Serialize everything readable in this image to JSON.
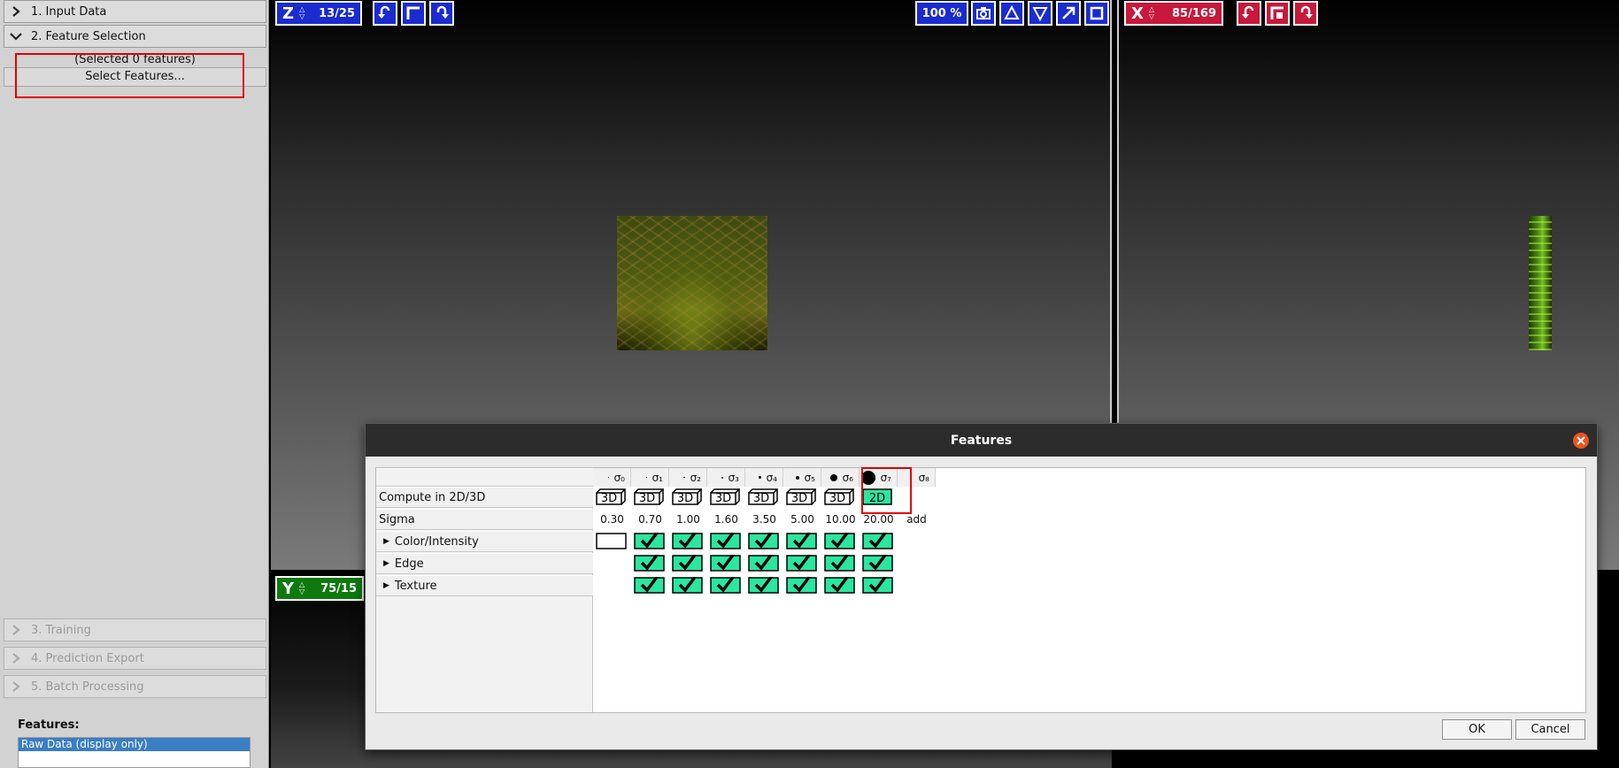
{
  "left_panel": {
    "drawers": [
      {
        "label": "1. Input Data",
        "expanded": false,
        "enabled": true
      },
      {
        "label": "2. Feature Selection",
        "expanded": true,
        "enabled": true
      },
      {
        "label": "3. Training",
        "expanded": false,
        "enabled": false
      },
      {
        "label": "4. Prediction Export",
        "expanded": false,
        "enabled": false
      },
      {
        "label": "5. Batch Processing",
        "expanded": false,
        "enabled": false
      }
    ],
    "selected_info": "(Selected 0 features)",
    "select_button": "Select Features...",
    "features_label": "Features:",
    "layer_item": "Raw Data (display only)"
  },
  "viewers": {
    "z": {
      "axis": "Z",
      "value": "13/25",
      "color": "#1a2bd0"
    },
    "x": {
      "axis": "X",
      "value": "85/169",
      "color": "#c8183b"
    },
    "y": {
      "axis": "Y",
      "value": "75/15",
      "color": "#0e7a0e"
    },
    "zoom": "100 %",
    "toolbar_icons": [
      "rotate-left-icon",
      "swap-axes-icon",
      "rotate-right-icon",
      "camera-icon",
      "triangle-up-icon",
      "triangle-down-icon",
      "maximize-icon",
      "square-icon"
    ]
  },
  "dialog": {
    "title": "Features",
    "row_labels": {
      "compute": "Compute in 2D/3D",
      "sigma": "Sigma",
      "groups": [
        "Color/Intensity",
        "Edge",
        "Texture"
      ]
    },
    "columns": [
      {
        "symbol": "σ₀",
        "mode": "3D",
        "sigma": "0.30"
      },
      {
        "symbol": "σ₁",
        "mode": "3D",
        "sigma": "0.70"
      },
      {
        "symbol": "σ₂",
        "mode": "3D",
        "sigma": "1.00"
      },
      {
        "symbol": "σ₃",
        "mode": "3D",
        "sigma": "1.60"
      },
      {
        "symbol": "σ₄",
        "mode": "3D",
        "sigma": "3.50"
      },
      {
        "symbol": "σ₅",
        "mode": "3D",
        "sigma": "5.00"
      },
      {
        "symbol": "σ₆",
        "mode": "3D",
        "sigma": "10.00"
      },
      {
        "symbol": "σ₇",
        "mode": "2D",
        "sigma": "20.00"
      },
      {
        "symbol": "σ₈",
        "mode": "",
        "sigma": "add"
      }
    ],
    "checks": [
      [
        false,
        true,
        true,
        true,
        true,
        true,
        true,
        true
      ],
      [
        null,
        true,
        true,
        true,
        true,
        true,
        true,
        true
      ],
      [
        null,
        true,
        true,
        true,
        true,
        true,
        true,
        true
      ]
    ],
    "ok": "OK",
    "cancel": "Cancel"
  },
  "colors": {
    "checked": "#2ae6a0",
    "highlight": "#e00000",
    "dialog_title_bg": "#2c2c2c",
    "close_button": "#e95420"
  }
}
